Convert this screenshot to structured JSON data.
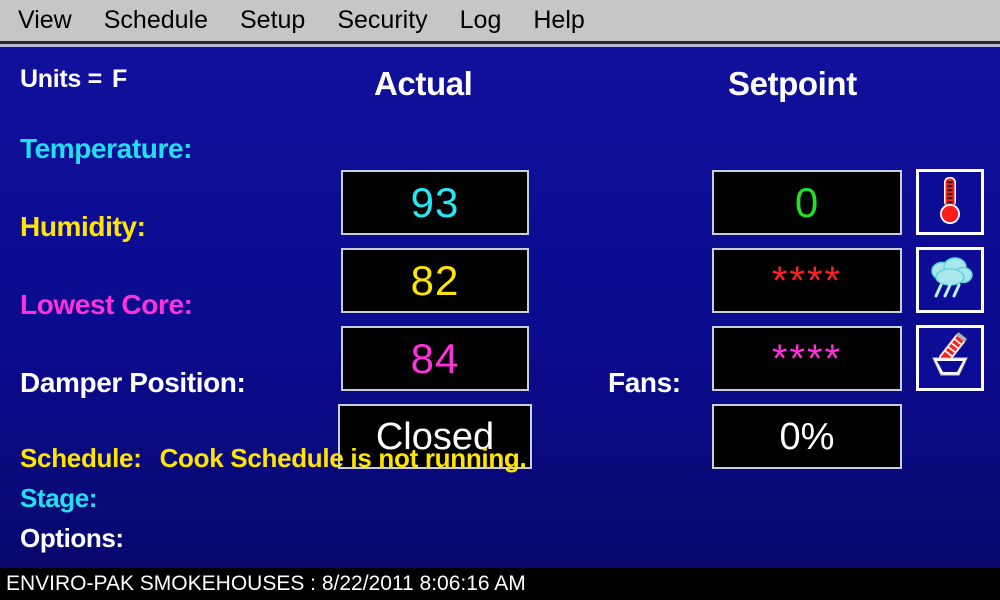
{
  "menubar": {
    "items": [
      {
        "label": "View",
        "name": "menu-view"
      },
      {
        "label": "Schedule",
        "name": "menu-schedule"
      },
      {
        "label": "Setup",
        "name": "menu-setup"
      },
      {
        "label": "Security",
        "name": "menu-security"
      },
      {
        "label": "Log",
        "name": "menu-log"
      },
      {
        "label": "Help",
        "name": "menu-help"
      }
    ]
  },
  "units": {
    "label": "Units =",
    "value": "F"
  },
  "headers": {
    "actual": "Actual",
    "setpoint": "Setpoint"
  },
  "rows": {
    "temperature": {
      "label": "Temperature:",
      "actual": "93",
      "setpoint": "0",
      "icon": "thermometer-icon",
      "label_color": "#20e0f0",
      "actual_color": "#24e8f4",
      "setpoint_color": "#22e022"
    },
    "humidity": {
      "label": "Humidity:",
      "actual": "82",
      "setpoint": "****",
      "icon": "cloud-rain-icon",
      "label_color": "#ffe500",
      "actual_color": "#ffe500",
      "setpoint_color": "#ff2020"
    },
    "lowest_core": {
      "label": "Lowest Core:",
      "actual": "84",
      "setpoint": "****",
      "icon": "core-probe-icon",
      "label_color": "#ff31d9",
      "actual_color": "#ff31d9",
      "setpoint_color": "#ff31d9"
    },
    "damper": {
      "label": "Damper Position:",
      "value": "Closed",
      "value_color": "#ffffff"
    },
    "fans": {
      "label": "Fans:",
      "value": "0%",
      "value_color": "#ffffff"
    }
  },
  "status": {
    "schedule_label": "Schedule:",
    "schedule_value": "Cook Schedule is not running.",
    "stage_label": "Stage:",
    "stage_value": "",
    "options_label": "Options:",
    "options_value": ""
  },
  "statusbar": {
    "text": "ENVIRO-PAK SMOKEHOUSES :  8/22/2011 8:06:16 AM"
  },
  "colors": {
    "background": "#0b0b8f",
    "menubar": "#c6c6c6",
    "box_background": "#000000",
    "box_border": "#c9cede",
    "statusbar": "#000000"
  }
}
